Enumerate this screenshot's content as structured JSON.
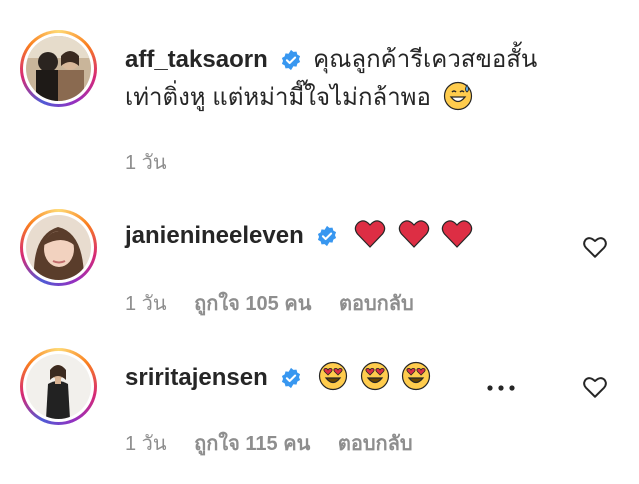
{
  "comments": [
    {
      "username": "aff_taksaorn",
      "text_line1": "คุณลูกค้ารีเควสขอสั้น",
      "text_line2": "เท่าติ่งหู แต่หม่ามี๊ใจไม่กล้าพอ",
      "emoji": [
        "grinning-sweat-emoji"
      ],
      "time": "1 วัน"
    },
    {
      "username": "janienineeleven",
      "emoji": [
        "red-heart-emoji",
        "red-heart-emoji",
        "red-heart-emoji"
      ],
      "time": "1 วัน",
      "likes": "ถูกใจ 105 คน",
      "reply": "ตอบกลับ"
    },
    {
      "username": "sriritajensen",
      "emoji": [
        "heart-eyes-emoji",
        "heart-eyes-emoji",
        "heart-eyes-emoji"
      ],
      "time": "1 วัน",
      "likes": "ถูกใจ 115 คน",
      "reply": "ตอบกลับ"
    }
  ],
  "colors": {
    "verified": "#3897f0",
    "meta": "#8e8e8e",
    "text": "#262626"
  }
}
